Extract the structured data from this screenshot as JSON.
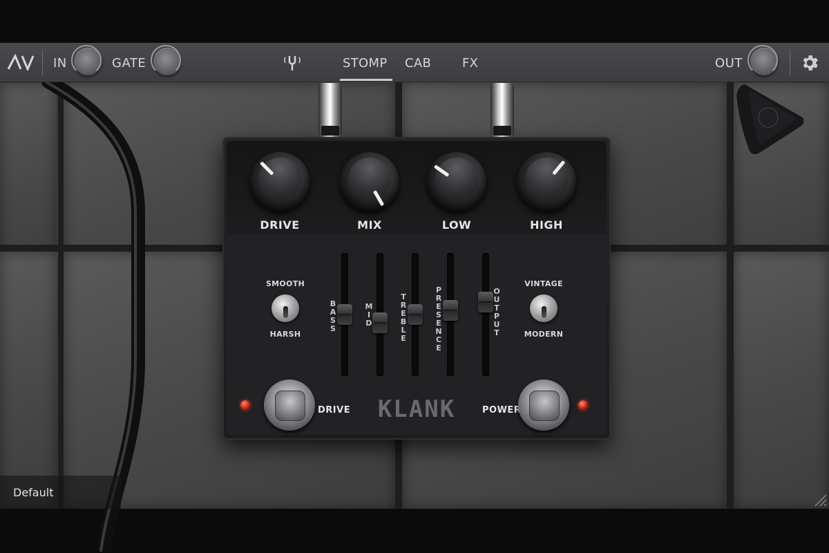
{
  "topbar": {
    "logo": "AV",
    "in_label": "IN",
    "gate_label": "GATE",
    "out_label": "OUT",
    "tuner_icon": "tuner-fork-icon",
    "settings_icon": "gear-icon",
    "tabs": [
      {
        "label": "STOMP",
        "active": true
      },
      {
        "label": "CAB",
        "active": false
      },
      {
        "label": "FX",
        "active": false
      }
    ]
  },
  "pedal": {
    "brand": "KLANK",
    "knobs": [
      {
        "label": "DRIVE"
      },
      {
        "label": "MIX"
      },
      {
        "label": "LOW"
      },
      {
        "label": "HIGH"
      }
    ],
    "sliders": [
      {
        "label": "BASS"
      },
      {
        "label": "MID"
      },
      {
        "label": "TREBLE"
      },
      {
        "label": "PRESENCE"
      },
      {
        "label": "OUTPUT"
      }
    ],
    "toggle_left": {
      "top": "SMOOTH",
      "bottom": "HARSH"
    },
    "toggle_right": {
      "top": "VINTAGE",
      "bottom": "MODERN"
    },
    "footswitch_left": {
      "label": "DRIVE"
    },
    "footswitch_right": {
      "label": "POWER"
    }
  },
  "preset": {
    "name": "Default"
  },
  "colors": {
    "led": "#c0261c",
    "topbar": "#3d3c40",
    "text": "#d6d5da"
  }
}
